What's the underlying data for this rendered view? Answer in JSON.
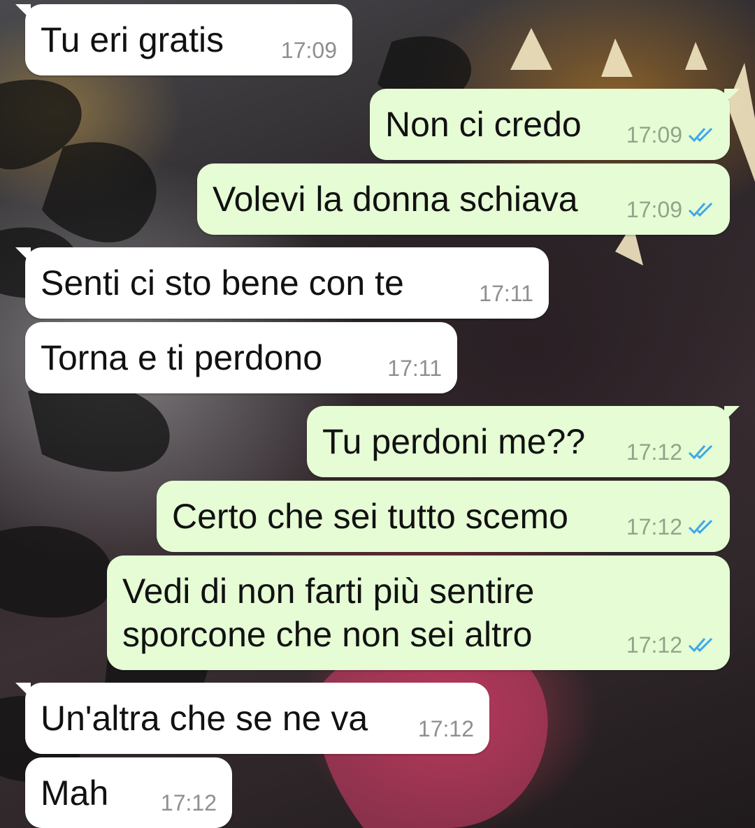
{
  "chat": {
    "wallpaper_icon": "tiger-wallpaper",
    "tick_color": "#3ea7e6",
    "incoming_color": "#ffffff",
    "outgoing_color": "#e5fcd5",
    "messages": [
      {
        "direction": "in",
        "text": "Tu eri gratis",
        "time": "17:09"
      },
      {
        "direction": "out",
        "text": "Non ci credo",
        "time": "17:09",
        "status": "read-ticks-icon"
      },
      {
        "direction": "out",
        "text": "Volevi la donna schiava",
        "time": "17:09",
        "status": "read-ticks-icon"
      },
      {
        "direction": "in",
        "text": "Senti ci sto bene con te",
        "time": "17:11"
      },
      {
        "direction": "in",
        "text": "Torna e ti perdono",
        "time": "17:11"
      },
      {
        "direction": "out",
        "text": "Tu perdoni me??",
        "time": "17:12",
        "status": "read-ticks-icon"
      },
      {
        "direction": "out",
        "text": "Certo che sei tutto scemo",
        "time": "17:12",
        "status": "read-ticks-icon"
      },
      {
        "direction": "out",
        "text": "Vedi di non farti più sentire\nsporcone che non sei altro",
        "time": "17:12",
        "status": "read-ticks-icon"
      },
      {
        "direction": "in",
        "text": "Un'altra che se ne va",
        "time": "17:12"
      },
      {
        "direction": "in",
        "text": "Mah",
        "time": "17:12"
      }
    ]
  }
}
